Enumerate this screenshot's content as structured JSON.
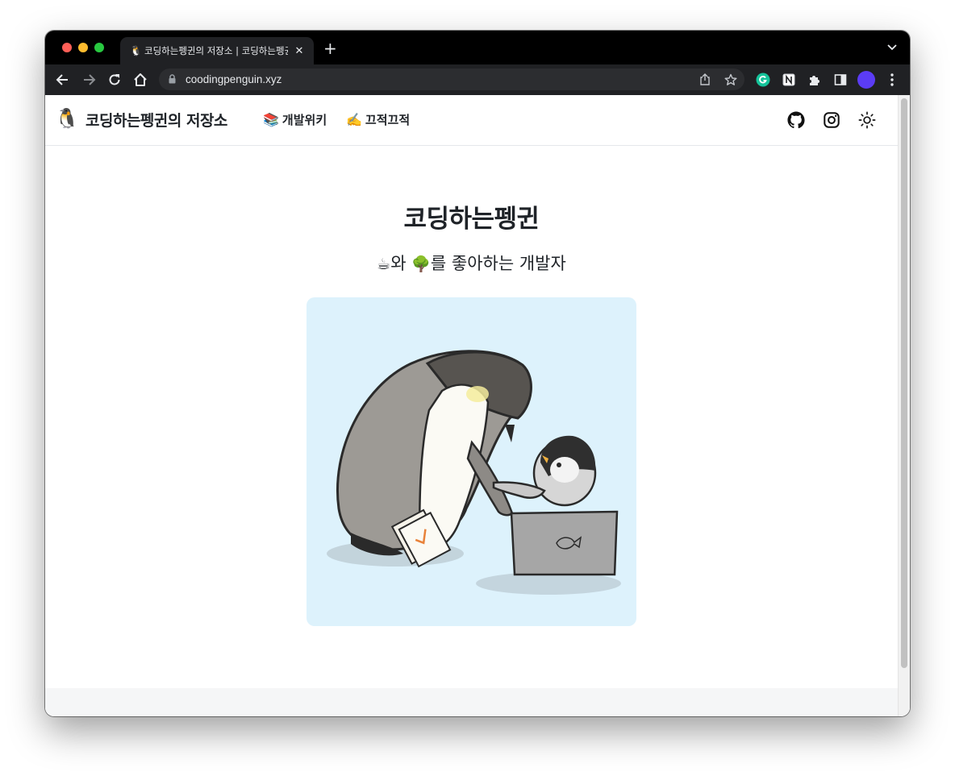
{
  "browser": {
    "tab": {
      "favicon": "🐧",
      "title": "코딩하는펭귄의 저장소 | 코딩하는펭귄",
      "close_icon": "close-icon"
    },
    "new_tab_label": "+",
    "url": "coodingpenguin.xyz",
    "profile_color": "#5b3cf5"
  },
  "site": {
    "logo": "🐧",
    "brand": "코딩하는펭귄의 저장소",
    "nav": [
      {
        "emoji": "📚",
        "label": "개발위키"
      },
      {
        "emoji": "✍️",
        "label": "끄적끄적"
      }
    ],
    "header_icons": [
      "github-icon",
      "instagram-icon",
      "sun-icon"
    ]
  },
  "hero": {
    "title": "코딩하는펭귄",
    "subtitle_parts": [
      "☕",
      "와 ",
      "🌳",
      "를 좋아하는 개발자"
    ],
    "illustration_bg": "#ddf2fc"
  }
}
